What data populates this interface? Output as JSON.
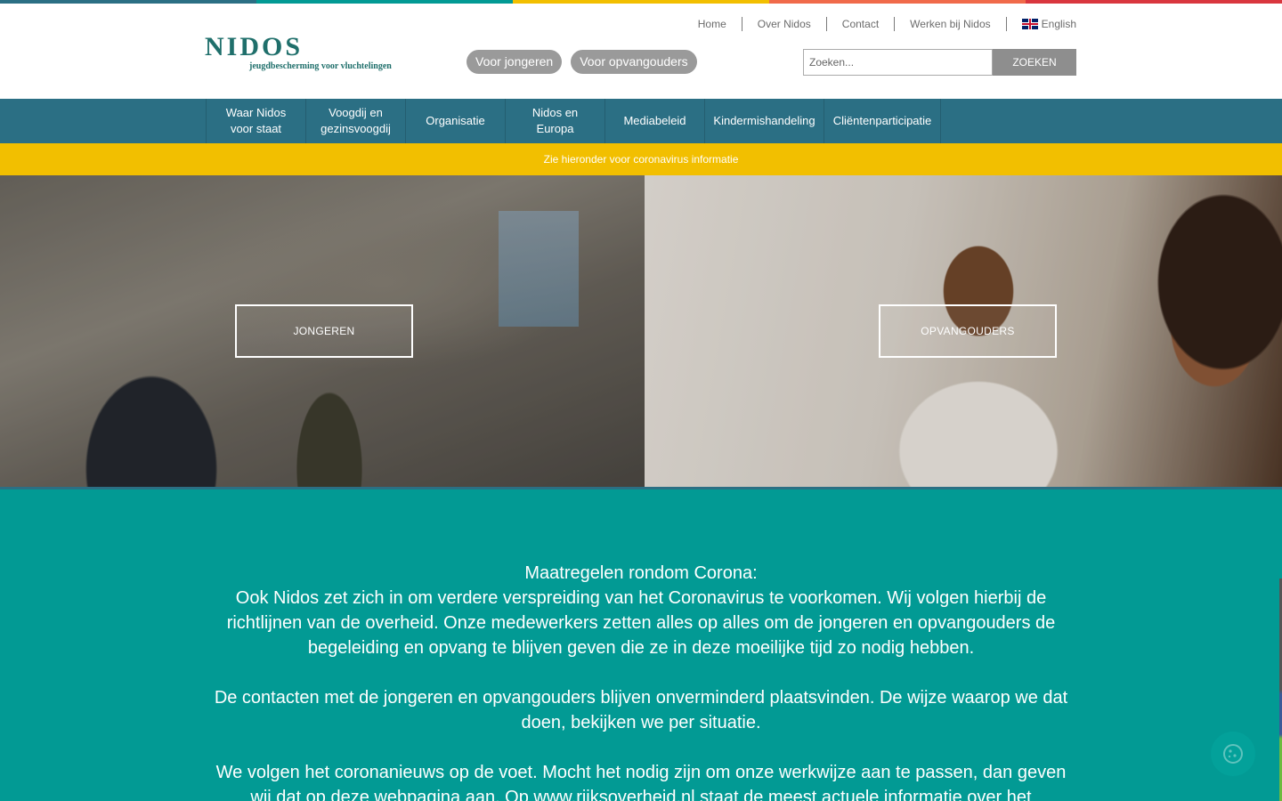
{
  "stripe_colors": [
    "#2b6f84",
    "#029a94",
    "#f2bf00",
    "#f06a4a",
    "#d9363e"
  ],
  "header": {
    "logo_name": "NIDOS",
    "logo_tagline": "jeugdbescherming voor vluchtelingen",
    "top_links": [
      "Home",
      "Over Nidos",
      "Contact",
      "Werken bij Nidos"
    ],
    "language_label": "English",
    "pill_buttons": [
      "Voor jongeren",
      "Voor opvangouders"
    ],
    "search_placeholder": "Zoeken...",
    "search_button": "ZOEKEN"
  },
  "nav": {
    "items": [
      "Waar Nidos voor staat",
      "Voogdij en gezinsvoogdij",
      "Organisatie",
      "Nidos en Europa",
      "Mediabeleid",
      "Kindermishandeling",
      "Cliëntenparticipatie"
    ]
  },
  "notice": "Zie hieronder voor coronavirus informatie",
  "hero": {
    "left_button": "JONGEREN",
    "right_button": "OPVANGOUDERS"
  },
  "corona": {
    "p1_title": "Maatregelen rondom Corona:",
    "p1_body": "Ook Nidos zet zich in om verdere verspreiding van het Coronavirus te voorkomen. Wij volgen hierbij de richtlijnen van de overheid. Onze medewerkers zetten alles op alles om de jongeren en opvangouders de begeleiding en opvang te blijven geven die ze in deze moeilijke tijd zo nodig hebben.",
    "p2": "De contacten met de jongeren en opvangouders blijven onverminderd plaatsvinden. De wijze waarop we dat doen, bekijken we per situatie.",
    "p3": "We volgen het coronanieuws op de voet. Mocht het nodig zijn om onze werkwijze aan te passen, dan geven wij dat op deze webpagina aan. Op www.rijksoverheid.nl staat de meest actuele informatie over het"
  },
  "colors": {
    "nav_bg": "#2b6f84",
    "notice_bg": "#f2bf00",
    "corona_bg": "#029a94",
    "brand": "#1f6f6b"
  }
}
